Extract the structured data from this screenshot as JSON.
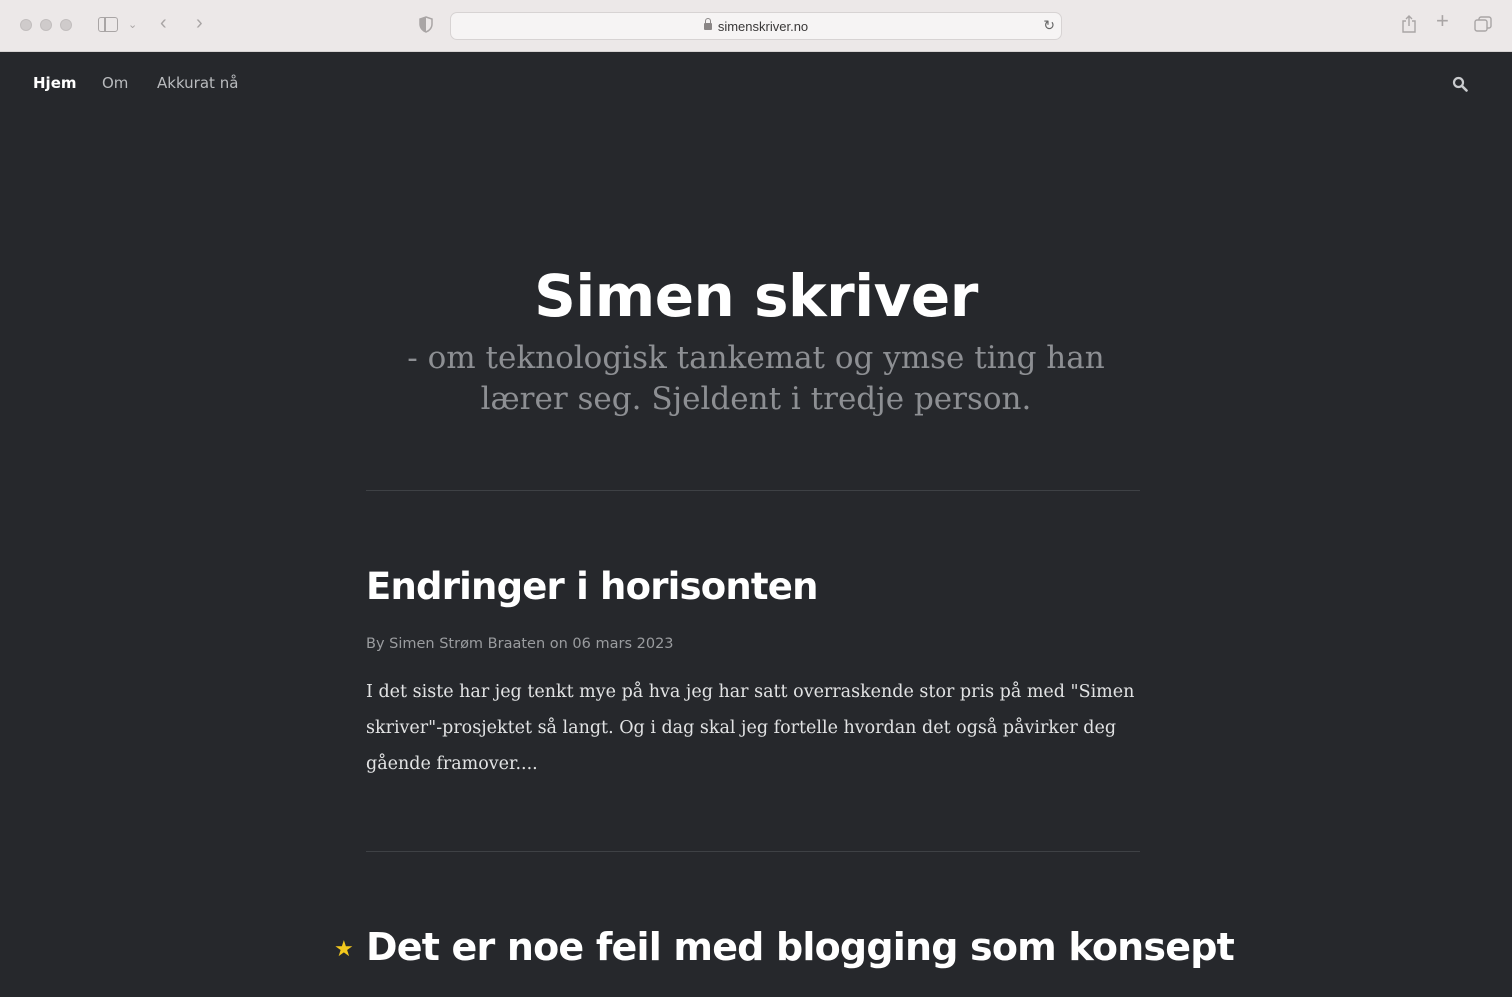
{
  "browser": {
    "url": "simenskriver.no"
  },
  "nav": {
    "home": "Hjem",
    "about": "Om",
    "now": "Akkurat nå"
  },
  "header": {
    "title": "Simen skriver",
    "tagline": "- om teknologisk tankemat og ymse ting han lærer seg. Sjeldent i tredje person."
  },
  "posts": [
    {
      "title": "Endringer i horisonten",
      "meta": "By Simen Strøm Braaten on 06 mars 2023",
      "excerpt": "I det siste har jeg tenkt mye på hva jeg har satt overraskende stor pris på med \"Simen skriver\"-prosjektet så langt. Og i dag skal jeg fortelle hvordan det også påvirker deg gående framover...."
    },
    {
      "title": "Det er noe feil med blogging som konsept",
      "featured": true,
      "icon": "star-icon"
    }
  ],
  "colors": {
    "background": "#26282c",
    "star": "#f2c81d"
  }
}
